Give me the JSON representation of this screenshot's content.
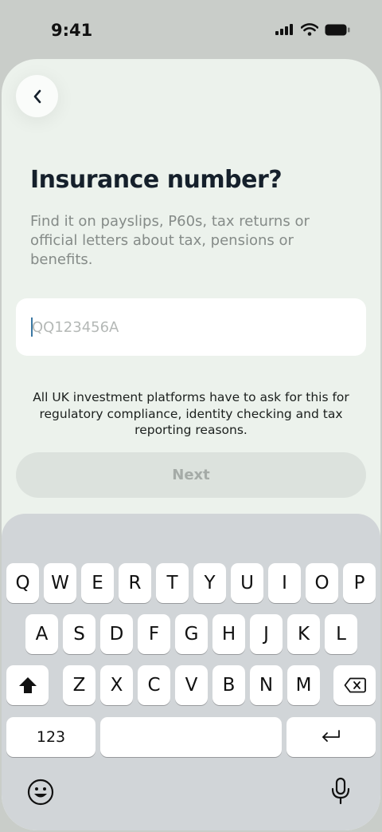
{
  "status_bar": {
    "time": "9:41"
  },
  "header": {
    "back_icon": "chevron-left-icon"
  },
  "main": {
    "title": "Insurance number?",
    "subtitle": "Find it on payslips, P60s, tax returns or official letters about tax, pensions or benefits.",
    "input": {
      "placeholder": "QQ123456A",
      "value": ""
    },
    "disclaimer": "All UK investment platforms have to ask for this for regulatory compliance, identity checking and tax reporting reasons.",
    "next_label": "Next"
  },
  "keyboard": {
    "row1": [
      "Q",
      "W",
      "E",
      "R",
      "T",
      "Y",
      "U",
      "I",
      "O",
      "P"
    ],
    "row2": [
      "A",
      "S",
      "D",
      "F",
      "G",
      "H",
      "J",
      "K",
      "L"
    ],
    "row3": [
      "Z",
      "X",
      "C",
      "V",
      "B",
      "N",
      "M"
    ],
    "numbers_label": "123",
    "icons": {
      "shift": "shift-icon",
      "delete": "backspace-icon",
      "return": "return-icon",
      "emoji": "emoji-icon",
      "dictation": "microphone-icon"
    }
  },
  "colors": {
    "accent_caret": "#3b78a3",
    "sheet_bg": "#ecf2ec",
    "title": "#15202b"
  }
}
